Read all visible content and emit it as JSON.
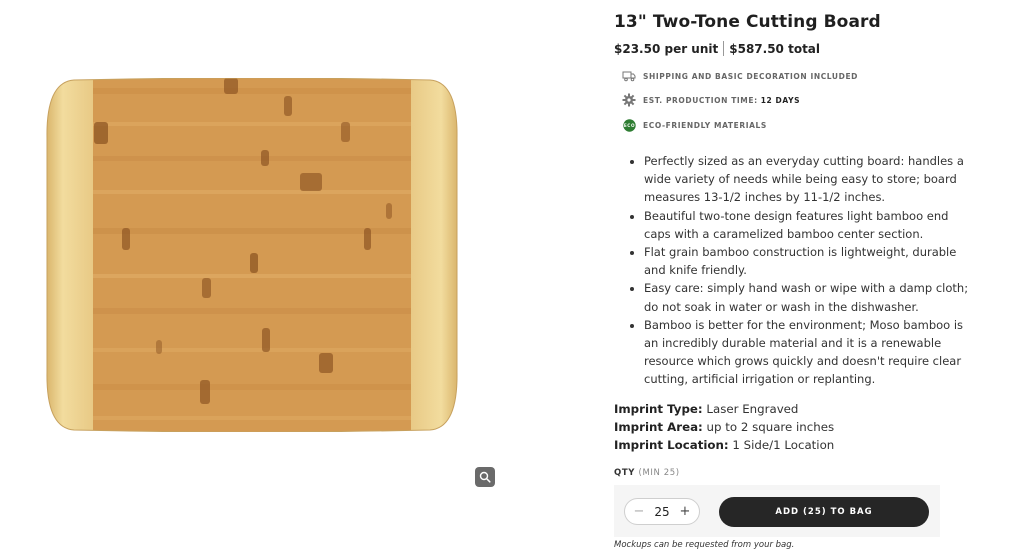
{
  "product": {
    "title": "13\" Two-Tone Cutting Board",
    "price_per_unit": "$23.50 per unit",
    "price_total": "$587.50 total"
  },
  "features": [
    {
      "icon": "truck-icon",
      "label": "SHIPPING AND BASIC DECORATION INCLUDED",
      "value": ""
    },
    {
      "icon": "gear-icon",
      "label": "EST. PRODUCTION TIME:",
      "value": "12 DAYS"
    },
    {
      "icon": "eco-badge-icon",
      "label": "ECO-FRIENDLY MATERIALS",
      "value": "",
      "badge_text": "ECO"
    }
  ],
  "description_bullets": [
    "Perfectly sized as an everyday cutting board: handles a wide variety of needs while being easy to store; board measures 13-1/2 inches by 11-1/2 inches.",
    "Beautiful two-tone design features light bamboo end caps with a caramelized bamboo center section.",
    "Flat grain bamboo construction is lightweight, durable and knife friendly.",
    "Easy care: simply hand wash or wipe with a damp cloth; do not soak in water or wash in the dishwasher.",
    "Bamboo is better for the environment; Moso bamboo is an incredibly durable material and it is a renewable resource which grows quickly and doesn't require clear cutting, artificial irrigation or replanting."
  ],
  "imprint": {
    "type_label": "Imprint Type:",
    "type_value": "Laser Engraved",
    "area_label": "Imprint Area:",
    "area_value": "up to 2 square inches",
    "location_label": "Imprint Location:",
    "location_value": "1 Side/1 Location"
  },
  "quantity": {
    "label": "QTY",
    "min_note": "(MIN 25)",
    "value": "25",
    "minus": "−",
    "plus": "+"
  },
  "add_button": "ADD (25) TO BAG",
  "mockup_note": "Mockups can be requested from your bag.",
  "colors": {
    "bamboo_light": "#ecd08c",
    "bamboo_center": "#d59a4f",
    "button_dark": "#262626",
    "eco_green": "#2e7d32"
  }
}
